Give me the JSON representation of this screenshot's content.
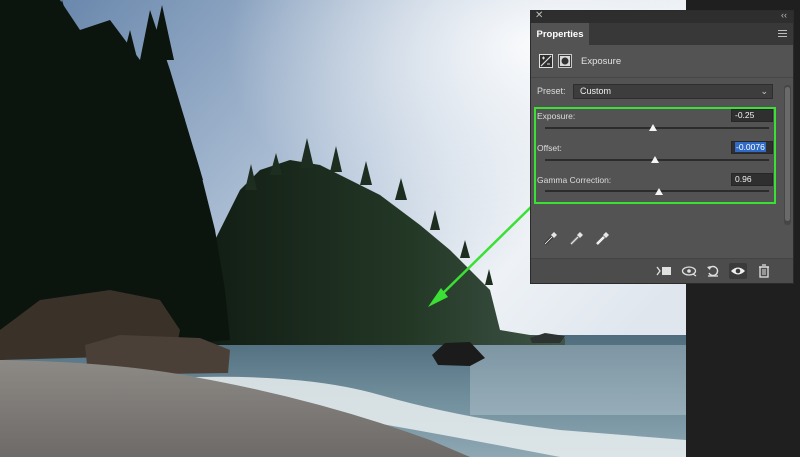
{
  "panel": {
    "title": "Properties",
    "close_glyph": "✕",
    "collapse_glyph": "‹‹",
    "adjustment_type": "Exposure",
    "preset": {
      "label": "Preset:",
      "value": "Custom"
    },
    "sliders": [
      {
        "label": "Exposure:",
        "value": "-0.25",
        "position": 0.48
      },
      {
        "label": "Offset:",
        "value": "-0.0076",
        "position": 0.49
      },
      {
        "label": "Gamma Correction:",
        "value": "0.96",
        "position": 0.51
      }
    ],
    "eyedroppers": [
      "eyedropper-black-icon",
      "eyedropper-gray-icon",
      "eyedropper-white-icon"
    ],
    "footer_icons": [
      "clip-to-layer-icon",
      "view-previous-state-icon",
      "reset-icon",
      "visibility-eye-icon",
      "trash-icon"
    ]
  },
  "colors": {
    "highlight": "#3be034",
    "panel_bg": "#535353",
    "selection": "#2f6ac6"
  }
}
